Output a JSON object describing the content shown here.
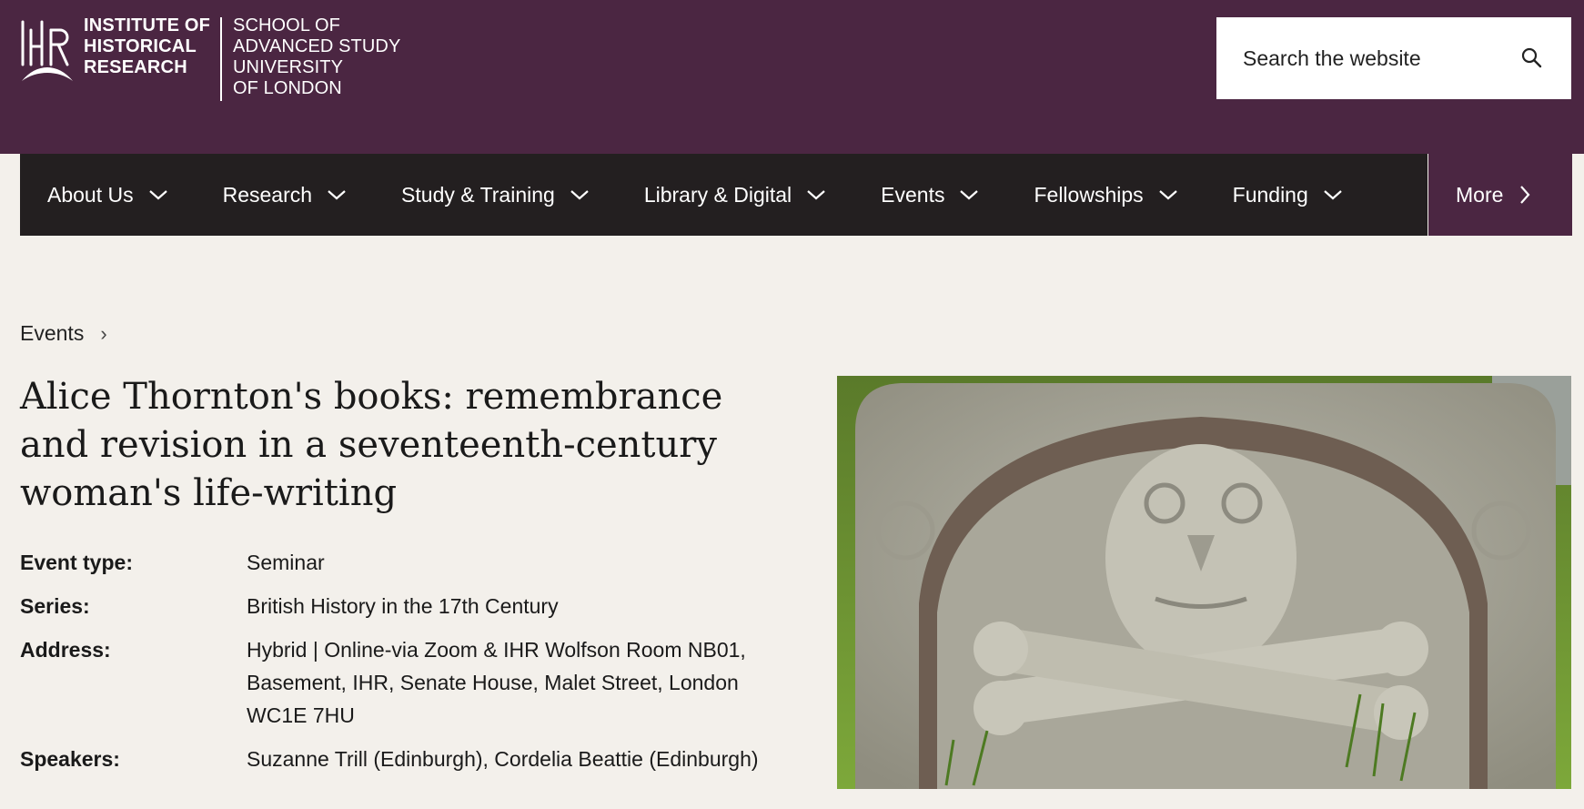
{
  "header": {
    "logo": {
      "ihr_lines": [
        "INSTITUTE OF",
        "HISTORICAL",
        "RESEARCH"
      ],
      "sas_lines": [
        "SCHOOL OF",
        "ADVANCED STUDY",
        "UNIVERSITY",
        "OF LONDON"
      ]
    },
    "search": {
      "placeholder": "Search the website"
    },
    "colors": {
      "brand": "#4b2642",
      "nav_bg": "#231f20",
      "page_bg": "#f3f0eb"
    }
  },
  "nav": {
    "items": [
      {
        "label": "About Us"
      },
      {
        "label": "Research"
      },
      {
        "label": "Study & Training"
      },
      {
        "label": "Library & Digital"
      },
      {
        "label": "Events"
      },
      {
        "label": "Fellowships"
      },
      {
        "label": "Funding"
      }
    ],
    "more_label": "More"
  },
  "breadcrumb": {
    "items": [
      {
        "label": "Events"
      }
    ]
  },
  "event": {
    "title": "Alice Thornton's books: remembrance and revision in a seventeenth-century woman's life-writing",
    "details": [
      {
        "label": "Event type:",
        "value": "Seminar"
      },
      {
        "label": "Series:",
        "value": "British History in the 17th Century"
      },
      {
        "label": "Address:",
        "value": "Hybrid | Online-via Zoom & IHR Wolfson Room NB01, Basement, IHR, Senate House, Malet Street, London WC1E 7HU"
      },
      {
        "label": "Speakers:",
        "value": "Suzanne Trill (Edinburgh), Cordelia Beattie (Edinburgh)"
      }
    ]
  },
  "icons": {
    "search": "search-icon",
    "chevron_down": "chevron-down-icon",
    "chevron_right": "chevron-right-icon"
  }
}
